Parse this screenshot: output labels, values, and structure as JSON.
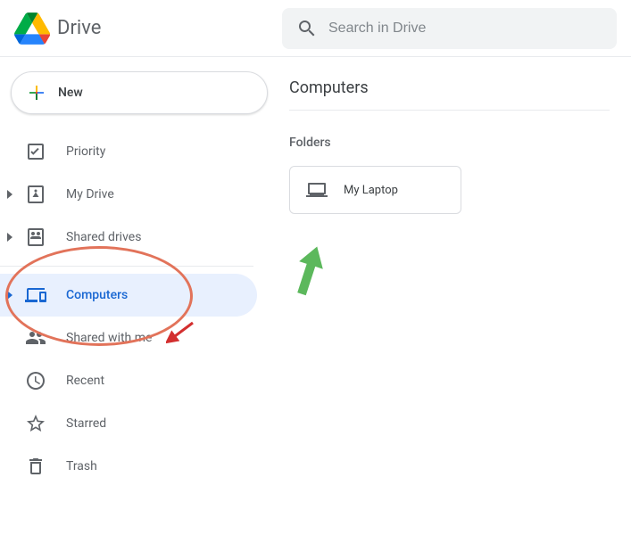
{
  "header": {
    "app_title": "Drive",
    "search_placeholder": "Search in Drive"
  },
  "sidebar": {
    "new_button_label": "New",
    "items": [
      {
        "label": "Priority"
      },
      {
        "label": "My Drive"
      },
      {
        "label": "Shared drives"
      },
      {
        "label": "Computers"
      },
      {
        "label": "Shared with me"
      },
      {
        "label": "Recent"
      },
      {
        "label": "Starred"
      },
      {
        "label": "Trash"
      }
    ]
  },
  "main": {
    "page_title": "Computers",
    "section_label": "Folders",
    "folders": [
      {
        "name": "My Laptop"
      }
    ]
  },
  "annotations": {
    "ellipse": "orange-circle-around-my-drive-and-shared-drives",
    "red_arrow_target": "computers-nav-item",
    "green_arrow_target": "my-laptop-folder"
  },
  "colors": {
    "accent": "#1967d2",
    "active_bg": "#e8f0fe",
    "ellipse": "#e2735a",
    "green_arrow": "#4caf50",
    "red_arrow": "#d32f2f"
  }
}
